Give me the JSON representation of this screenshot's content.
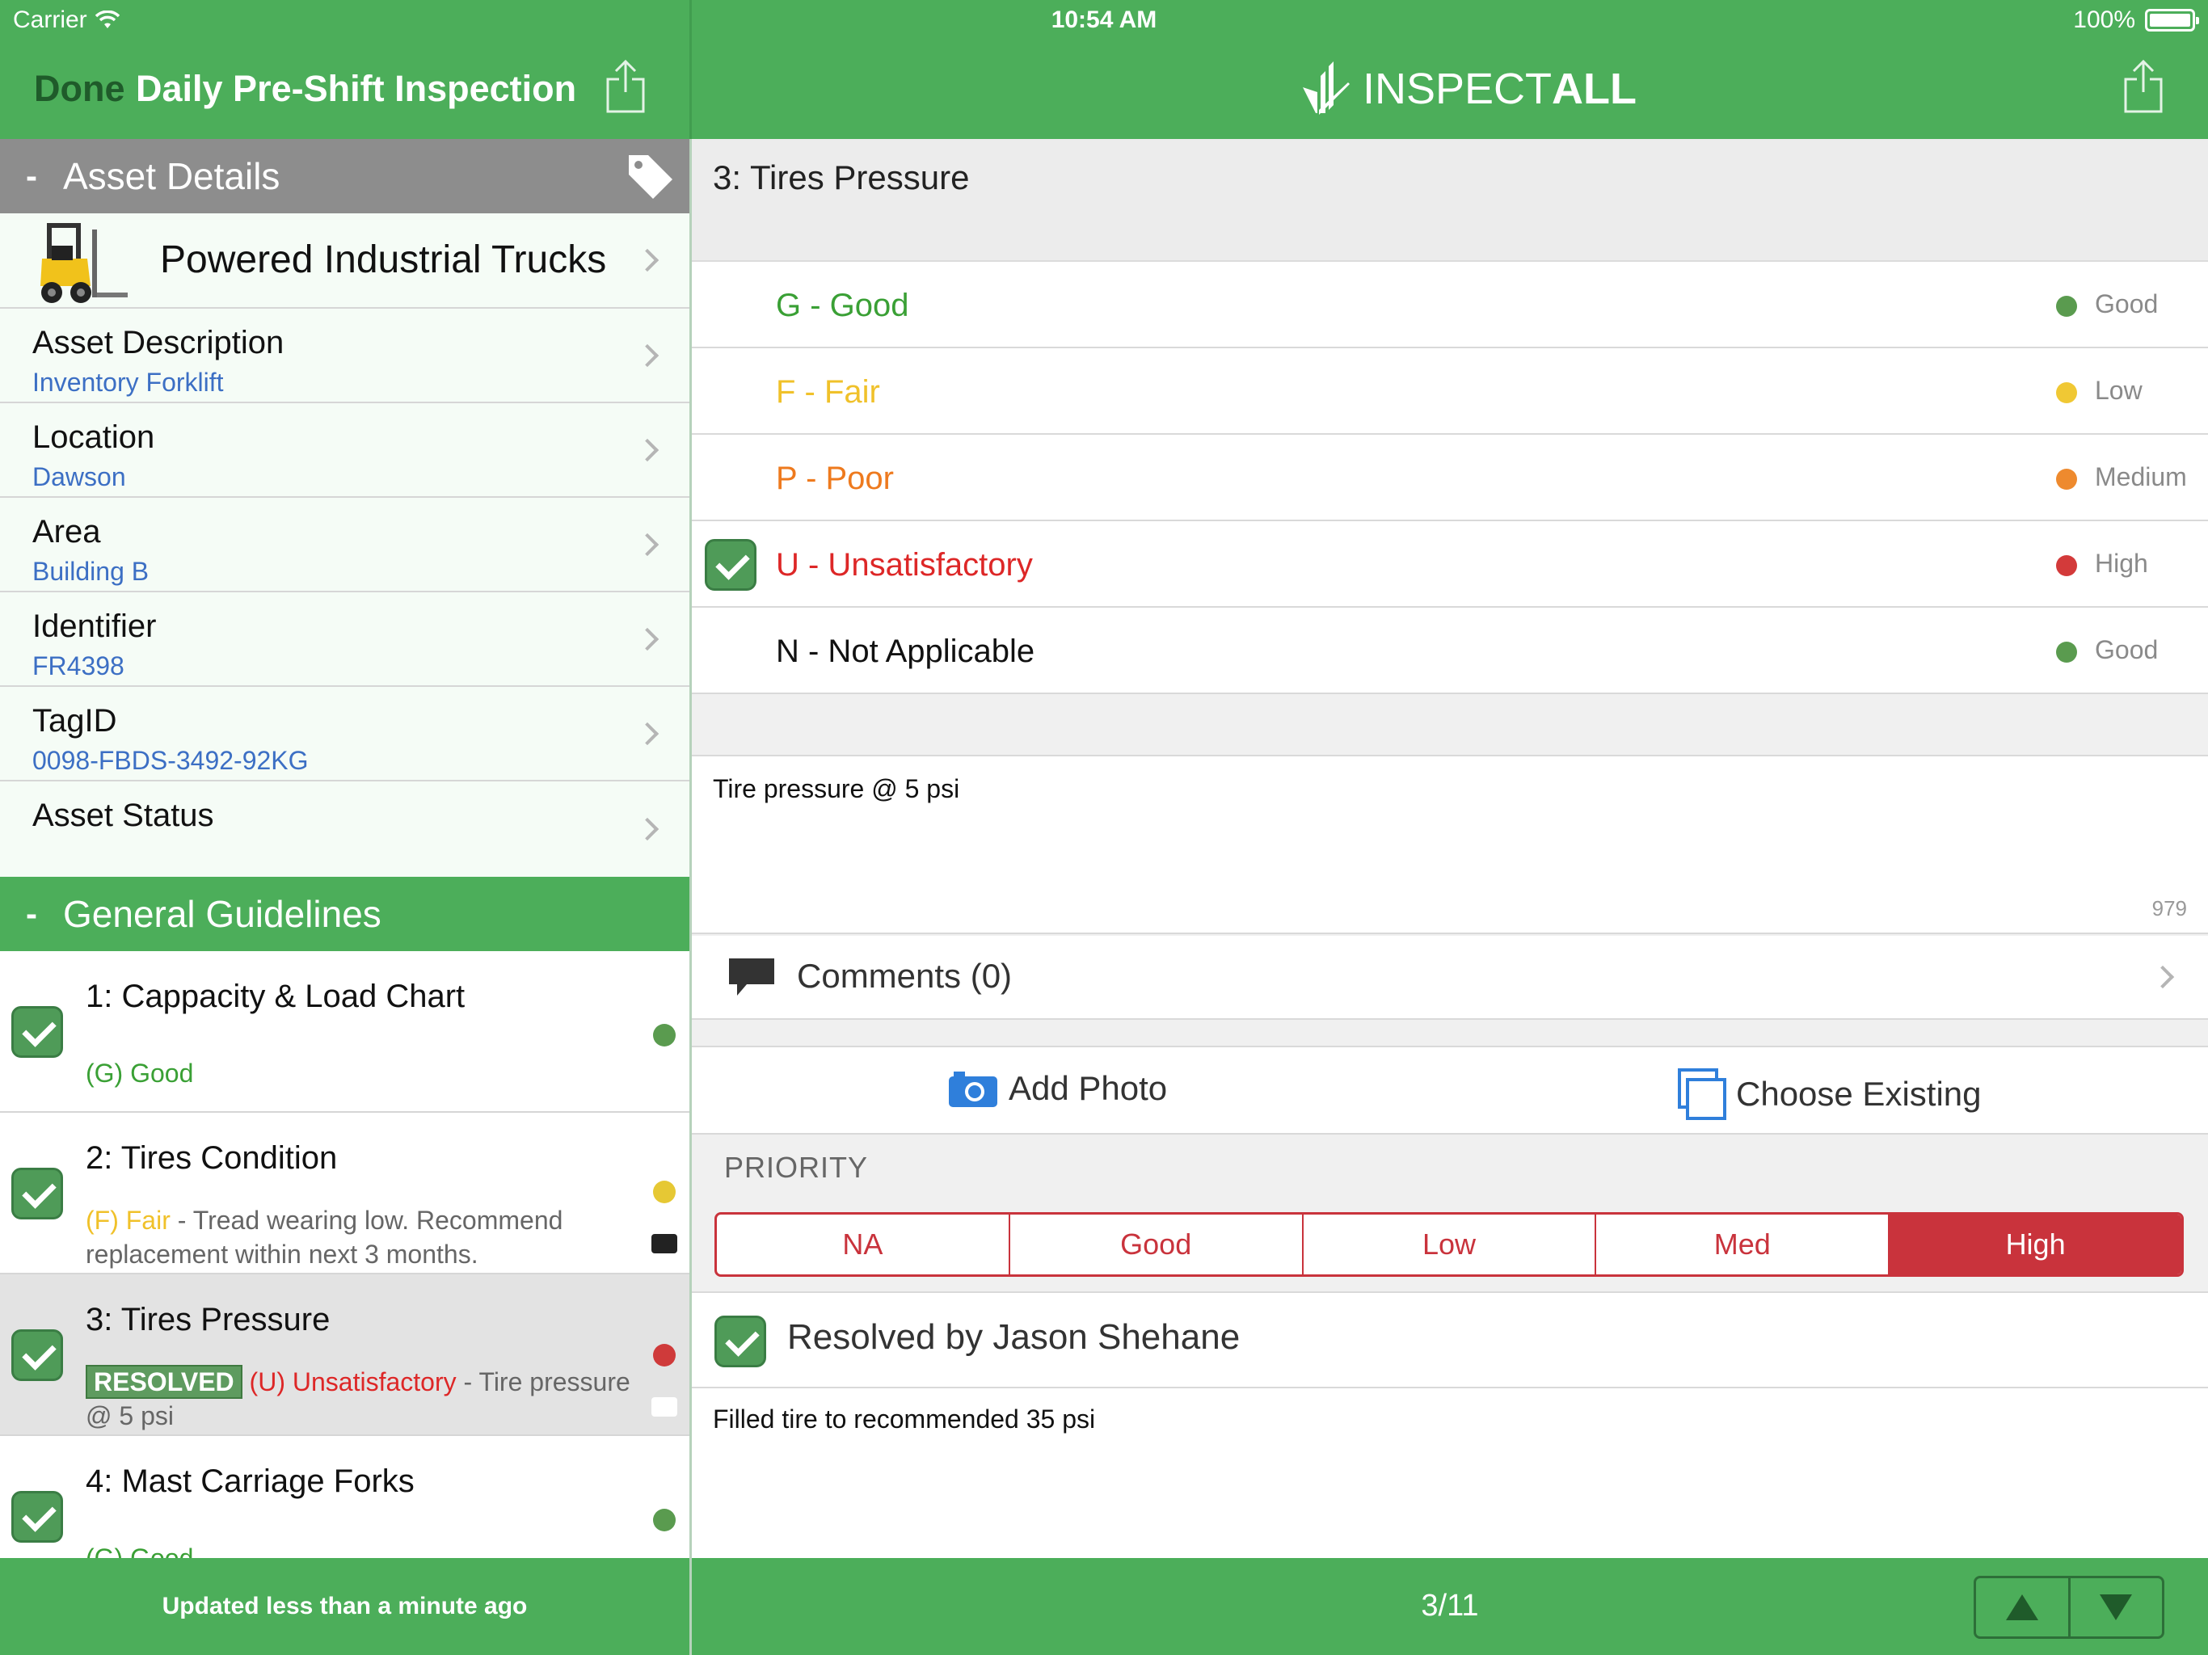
{
  "status_bar": {
    "carrier": "Carrier",
    "time": "10:54 AM",
    "battery": "100%"
  },
  "left_nav": {
    "done": "Done",
    "title": "Daily Pre-Shift Inspection"
  },
  "brand": {
    "name_light": "INSPECT",
    "name_bold": "ALL"
  },
  "asset_details": {
    "header": "Asset Details",
    "collapse": "-",
    "type": "Powered Industrial Trucks",
    "rows": [
      {
        "label": "Asset Description",
        "value": "Inventory Forklift"
      },
      {
        "label": "Location",
        "value": "Dawson"
      },
      {
        "label": "Area",
        "value": "Building B"
      },
      {
        "label": "Identifier",
        "value": "FR4398"
      },
      {
        "label": "TagID",
        "value": "0098-FBDS-3492-92KG"
      },
      {
        "label": "Asset Status",
        "value": ""
      }
    ]
  },
  "guidelines": {
    "header": "General Guidelines",
    "collapse": "-",
    "items": [
      {
        "title": "1: Cappacity & Load Chart",
        "code": "(G) Good",
        "note": "",
        "dot": "#5a9b4f"
      },
      {
        "title": "2: Tires Condition",
        "code": "(F) Fair",
        "note": " - Tread wearing low.  Recommend replacement within next 3 months.",
        "dot": "#e6c834"
      },
      {
        "title": "3: Tires Pressure",
        "badge": "RESOLVED",
        "code": "(U) Unsatisfactory",
        "note": " - Tire pressure @ 5 psi",
        "dot": "#cf3a3a"
      },
      {
        "title": "4: Mast Carriage Forks",
        "code": "(G) Good",
        "note": "",
        "dot": "#5a9b4f"
      }
    ]
  },
  "left_footer": "Updated less than a minute ago",
  "question": {
    "title": "3: Tires Pressure",
    "options": [
      {
        "label": "G - Good",
        "priority": "Good",
        "color": "#3aa035",
        "dot": "#5a9b4f",
        "checked": false
      },
      {
        "label": "F - Fair",
        "priority": "Low",
        "color": "#f0c12a",
        "dot": "#f0c834",
        "checked": false
      },
      {
        "label": "P - Poor",
        "priority": "Medium",
        "color": "#ee7a1e",
        "dot": "#ee8a2e",
        "checked": false
      },
      {
        "label": "U - Unsatisfactory",
        "priority": "High",
        "color": "#dd2727",
        "dot": "#d33a3a",
        "checked": true
      },
      {
        "label": "N - Not Applicable",
        "priority": "Good",
        "color": "#111111",
        "dot": "#5a9b4f",
        "checked": false
      }
    ],
    "note": "Tire pressure @ 5 psi",
    "note_count": "979",
    "comments": "Comments (0)",
    "add_photo": "Add Photo",
    "choose_existing": "Choose Existing",
    "priority_label": "PRIORITY",
    "priority_options": [
      "NA",
      "Good",
      "Low",
      "Med",
      "High"
    ],
    "priority_selected": "High",
    "resolved_by": "Resolved by Jason Shehane",
    "resolution_note": "Filled tire to recommended 35 psi"
  },
  "pager": "3/11",
  "colors": {
    "brand_green": "#4cae5a",
    "danger": "#c9333c",
    "link_blue": "#3c6fc4"
  }
}
